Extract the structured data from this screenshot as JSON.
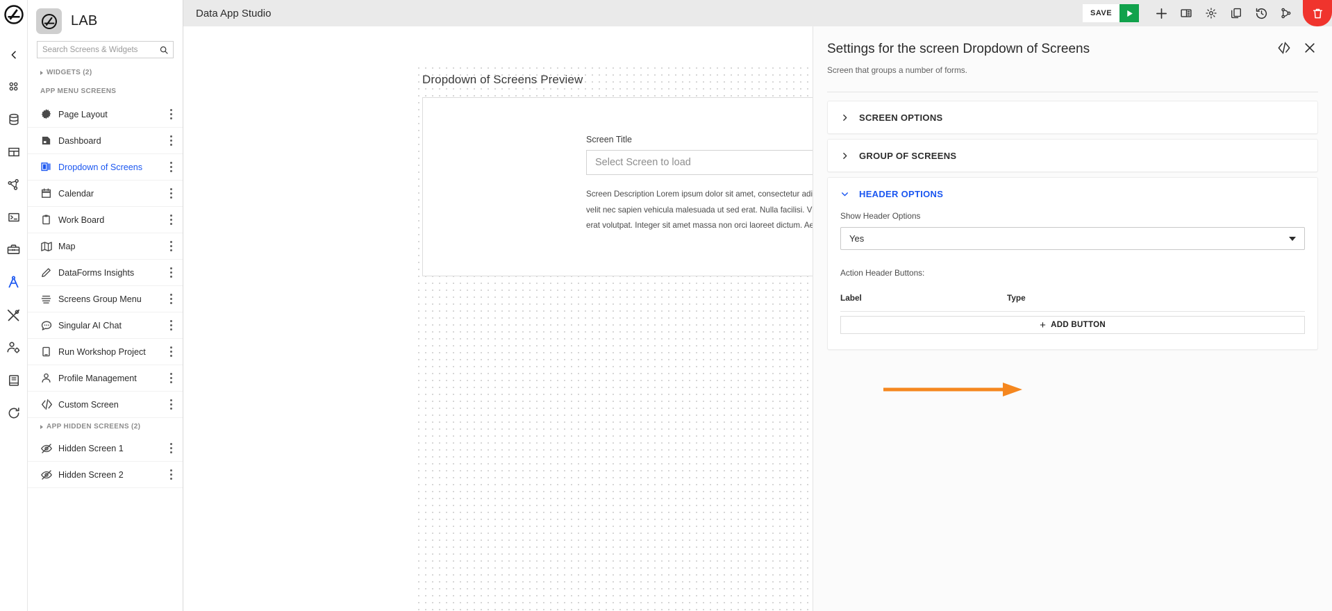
{
  "header": {
    "app_title": "Data App Studio",
    "logo_icon": "ring-slash-logo-icon"
  },
  "toolbar": {
    "save_label": "SAVE",
    "run_icon": "play-icon",
    "items": [
      {
        "icon": "plus-icon",
        "name": "add-button"
      },
      {
        "icon": "panel-layout-icon",
        "name": "layout-button"
      },
      {
        "icon": "gear-icon",
        "name": "settings-button"
      },
      {
        "icon": "copy-icon",
        "name": "duplicate-button"
      },
      {
        "icon": "history-icon",
        "name": "history-button"
      },
      {
        "icon": "branch-icon",
        "name": "version-branch-button"
      }
    ],
    "delete_icon": "trash-icon",
    "delete_color": "#f0342d",
    "save_accent_color": "#11a24c"
  },
  "rail": {
    "collapse_icon": "chevron-left-icon",
    "items": [
      {
        "icon": "grid-dots-icon",
        "name": "apps",
        "active": false
      },
      {
        "icon": "database-icon",
        "name": "data-sources",
        "active": false
      },
      {
        "icon": "table-icon",
        "name": "tables",
        "active": false
      },
      {
        "icon": "network-share-icon",
        "name": "pipelines",
        "active": false
      },
      {
        "icon": "terminal-icon",
        "name": "console",
        "active": false
      },
      {
        "icon": "toolbox-icon",
        "name": "toolbox",
        "active": false
      },
      {
        "icon": "compass-icon",
        "name": "data-app-studio",
        "active": true
      },
      {
        "icon": "tools-icon",
        "name": "utilities",
        "active": false
      },
      {
        "icon": "user-settings-icon",
        "name": "user-admin",
        "active": false
      },
      {
        "icon": "book-icon",
        "name": "docs",
        "active": false
      },
      {
        "icon": "refresh-icon",
        "name": "refresh",
        "active": false
      }
    ]
  },
  "sidebar": {
    "project_name": "LAB",
    "project_avatar_icon": "ring-slash-logo-icon",
    "search_placeholder": "Search Screens & Widgets",
    "search_value": "",
    "search_icon": "search-icon",
    "widgets_group": "WIDGETS (2)",
    "app_menu_label": "APP MENU SCREENS",
    "hidden_group": "APP HIDDEN SCREENS (2)",
    "screens": [
      {
        "label": "Page Layout",
        "icon": "starburst-icon",
        "active": false
      },
      {
        "label": "Dashboard",
        "icon": "dashboard-icon",
        "active": false
      },
      {
        "label": "Dropdown of Screens",
        "icon": "stacked-cards-icon",
        "active": true
      },
      {
        "label": "Calendar",
        "icon": "calendar-icon",
        "active": false
      },
      {
        "label": "Work Board",
        "icon": "clipboard-icon",
        "active": false
      },
      {
        "label": "Map",
        "icon": "map-icon",
        "active": false
      },
      {
        "label": "DataForms Insights",
        "icon": "pencil-icon",
        "active": false
      },
      {
        "label": "Screens Group Menu",
        "icon": "menu-lines-icon",
        "active": false
      },
      {
        "label": "Singular AI Chat",
        "icon": "chat-bubble-icon",
        "active": false
      },
      {
        "label": "Run Workshop Project",
        "icon": "mobile-icon",
        "active": false
      },
      {
        "label": "Profile Management",
        "icon": "person-icon",
        "active": false
      },
      {
        "label": "Custom Screen",
        "icon": "code-icon",
        "active": false
      }
    ],
    "hidden_screens": [
      {
        "label": "Hidden Screen 1",
        "icon": "eye-off-icon"
      },
      {
        "label": "Hidden Screen 2",
        "icon": "eye-off-icon"
      }
    ],
    "row_menu_icon": "kebab-menu-icon",
    "active_color": "#1a56f0"
  },
  "canvas": {
    "preview_title": "Dropdown of Screens Preview",
    "field_label": "Screen Title",
    "select_placeholder": "Select Screen to load",
    "description": "Screen Description Lorem ipsum dolor sit amet, consectetur adipiscing elit. Quisque ultricies, ex nec\nvelit nec sapien vehicula malesuada ut sed erat. Nulla facilisi. Vivamus volutpat, metus vel congue ve\nerat volutpat. Integer sit amet massa non orci laoreet dictum. Aenean a ultricies augue. Donec gravid"
  },
  "settings": {
    "title": "Settings for the screen Dropdown of Screens",
    "subtitle": "Screen that groups a number of forms.",
    "code_icon": "code-brackets-icon",
    "close_icon": "close-icon",
    "sections": [
      {
        "title": "SCREEN OPTIONS",
        "open": false,
        "chevron": "chevron-right-icon"
      },
      {
        "title": "GROUP OF SCREENS",
        "open": false,
        "chevron": "chevron-right-icon"
      },
      {
        "title": "HEADER OPTIONS",
        "open": true,
        "chevron": "chevron-down-icon"
      }
    ],
    "header_options": {
      "show_header_label": "Show Header Options",
      "show_header_value": "Yes",
      "action_buttons_label": "Action Header Buttons:",
      "table_headers": {
        "label": "Label",
        "type": "Type"
      },
      "rows": [],
      "add_button_label": "ADD BUTTON"
    },
    "accent_color": "#1a56f0"
  },
  "annotation": {
    "arrow_color": "#f5871f",
    "points_to": "add-button-row"
  }
}
